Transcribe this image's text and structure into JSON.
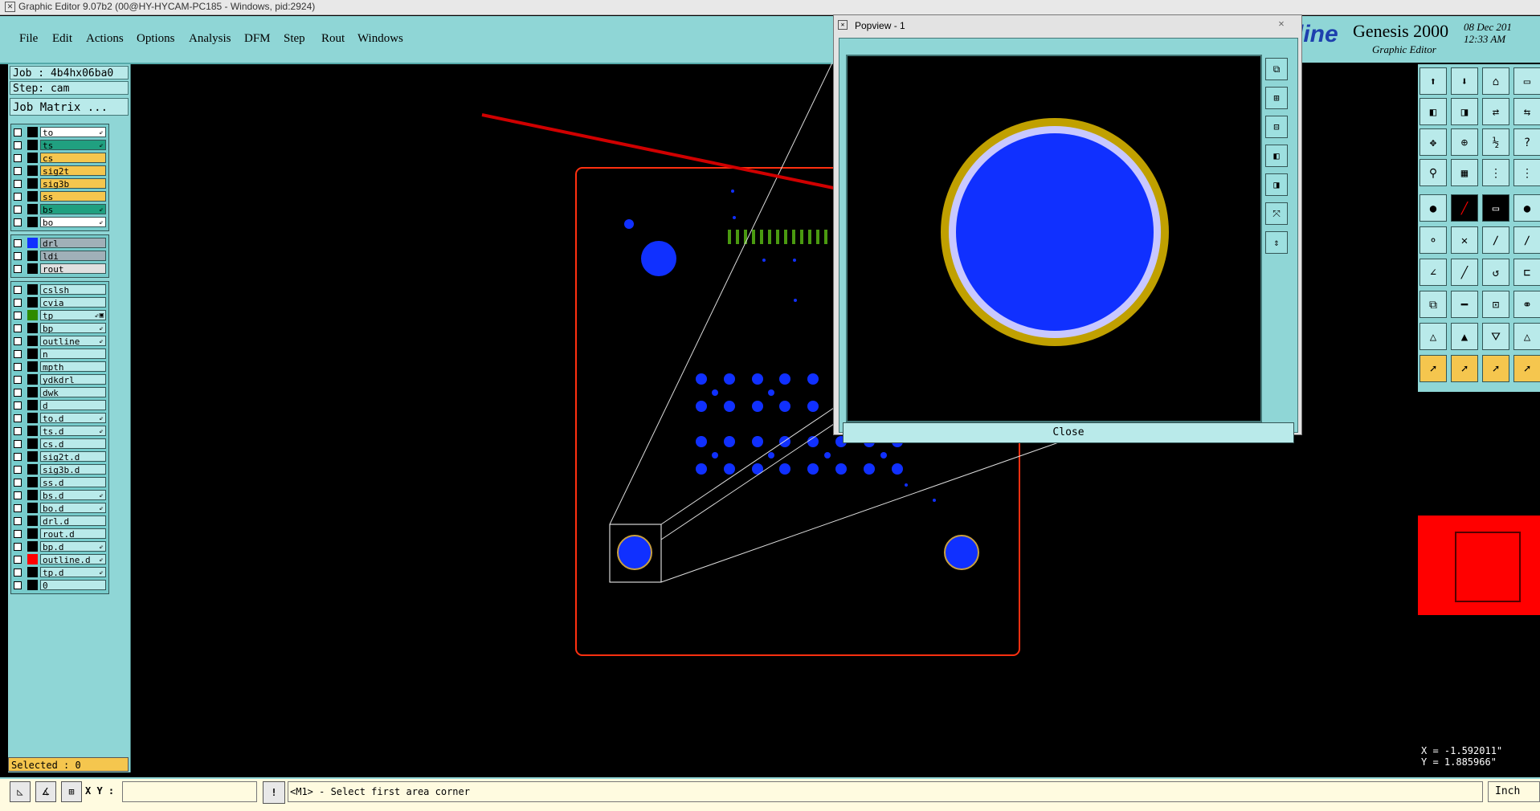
{
  "window_title": "Graphic Editor 9.07b2 (00@HY-HYCAM-PC185 - Windows, pid:2924)",
  "menu": {
    "items": [
      {
        "label": "File"
      },
      {
        "label": "Edit"
      },
      {
        "label": "Actions"
      },
      {
        "label": "Options"
      },
      {
        "label": "Analysis"
      },
      {
        "label": "DFM"
      },
      {
        "label": "Step"
      },
      {
        "label": "Rout"
      },
      {
        "label": "Windows"
      }
    ]
  },
  "brand": {
    "logo_text": "tline",
    "title": "Genesis 2000",
    "subtitle": "Graphic Editor",
    "date": "08 Dec 201",
    "time": "12:33 AM"
  },
  "left": {
    "job": "Job : 4b4hx06ba0",
    "step": "Step: cam",
    "job_matrix": "Job Matrix ...",
    "selected": "Selected : 0"
  },
  "layers": [
    {
      "name": "to",
      "bg": "#ffffff",
      "sw": "#000000",
      "flag": "⇙"
    },
    {
      "name": "ts",
      "bg": "#20a080",
      "sw": "#000000",
      "flag": "⇙"
    },
    {
      "name": "cs",
      "bg": "#f5c64e",
      "sw": "#000000",
      "flag": ""
    },
    {
      "name": "sig2t",
      "bg": "#f5c64e",
      "sw": "#000000",
      "flag": ""
    },
    {
      "name": "sig3b",
      "bg": "#f5c64e",
      "sw": "#000000",
      "flag": ""
    },
    {
      "name": "ss",
      "bg": "#f5c64e",
      "sw": "#000000",
      "flag": ""
    },
    {
      "name": "bs",
      "bg": "#20a080",
      "sw": "#000000",
      "flag": "⇙"
    },
    {
      "name": "bo",
      "bg": "#ffffff",
      "sw": "#000000",
      "flag": "⇙"
    },
    {
      "name": "drl",
      "bg": "#a0b0b8",
      "sw": "#1030ff",
      "flag": ""
    },
    {
      "name": "ldi",
      "bg": "#a0b0b8",
      "sw": "#000000",
      "flag": ""
    },
    {
      "name": "rout",
      "bg": "#e0e0e0",
      "sw": "#000000",
      "flag": ""
    },
    {
      "name": "cslsh",
      "bg": "#b9eaea",
      "sw": "#000000",
      "flag": ""
    },
    {
      "name": "cvia",
      "bg": "#b9eaea",
      "sw": "#000000",
      "flag": ""
    },
    {
      "name": "tp",
      "bg": "#b9eaea",
      "sw": "#2e8b00",
      "flag": "⇙▣"
    },
    {
      "name": "bp",
      "bg": "#b9eaea",
      "sw": "#000000",
      "flag": "⇙"
    },
    {
      "name": "outline",
      "bg": "#b9eaea",
      "sw": "#000000",
      "flag": "⇙"
    },
    {
      "name": "n",
      "bg": "#b9eaea",
      "sw": "#000000",
      "flag": ""
    },
    {
      "name": "mpth",
      "bg": "#b9eaea",
      "sw": "#000000",
      "flag": ""
    },
    {
      "name": "ydkdrl",
      "bg": "#b9eaea",
      "sw": "#000000",
      "flag": ""
    },
    {
      "name": "dwk",
      "bg": "#b9eaea",
      "sw": "#000000",
      "flag": ""
    },
    {
      "name": "d",
      "bg": "#b9eaea",
      "sw": "#000000",
      "flag": ""
    },
    {
      "name": "to.d",
      "bg": "#b9eaea",
      "sw": "#000000",
      "flag": "⇙"
    },
    {
      "name": "ts.d",
      "bg": "#b9eaea",
      "sw": "#000000",
      "flag": "⇙"
    },
    {
      "name": "cs.d",
      "bg": "#b9eaea",
      "sw": "#000000",
      "flag": ""
    },
    {
      "name": "sig2t.d",
      "bg": "#b9eaea",
      "sw": "#000000",
      "flag": ""
    },
    {
      "name": "sig3b.d",
      "bg": "#b9eaea",
      "sw": "#000000",
      "flag": ""
    },
    {
      "name": "ss.d",
      "bg": "#b9eaea",
      "sw": "#000000",
      "flag": ""
    },
    {
      "name": "bs.d",
      "bg": "#b9eaea",
      "sw": "#000000",
      "flag": "⇙"
    },
    {
      "name": "bo.d",
      "bg": "#b9eaea",
      "sw": "#000000",
      "flag": "⇙"
    },
    {
      "name": "drl.d",
      "bg": "#b9eaea",
      "sw": "#000000",
      "flag": ""
    },
    {
      "name": "rout.d",
      "bg": "#b9eaea",
      "sw": "#000000",
      "flag": ""
    },
    {
      "name": "bp.d",
      "bg": "#b9eaea",
      "sw": "#000000",
      "flag": "⇙"
    },
    {
      "name": "outline.d",
      "bg": "#b9eaea",
      "sw": "#ff0000",
      "flag": "⇙"
    },
    {
      "name": "tp.d",
      "bg": "#b9eaea",
      "sw": "#000000",
      "flag": "⇙"
    },
    {
      "name": "0",
      "bg": "#b9eaea",
      "sw": "#000000",
      "flag": ""
    }
  ],
  "popview": {
    "title": "Popview - 1",
    "close_label": "Close"
  },
  "coords": {
    "x": "X = -1.592011\"",
    "y": "Y =  1.885966\""
  },
  "bottom": {
    "xy_label": "X Y :",
    "xy_value": "",
    "message": "<M1> - Select first area corner",
    "unit": "Inch"
  },
  "colors": {
    "panel": "#8fd6d6",
    "pad": "#1030ff",
    "outline": "#ff3010",
    "arrow": "#d00000",
    "ring": "#c0a000",
    "ring_inner": "#c8c8ff"
  }
}
